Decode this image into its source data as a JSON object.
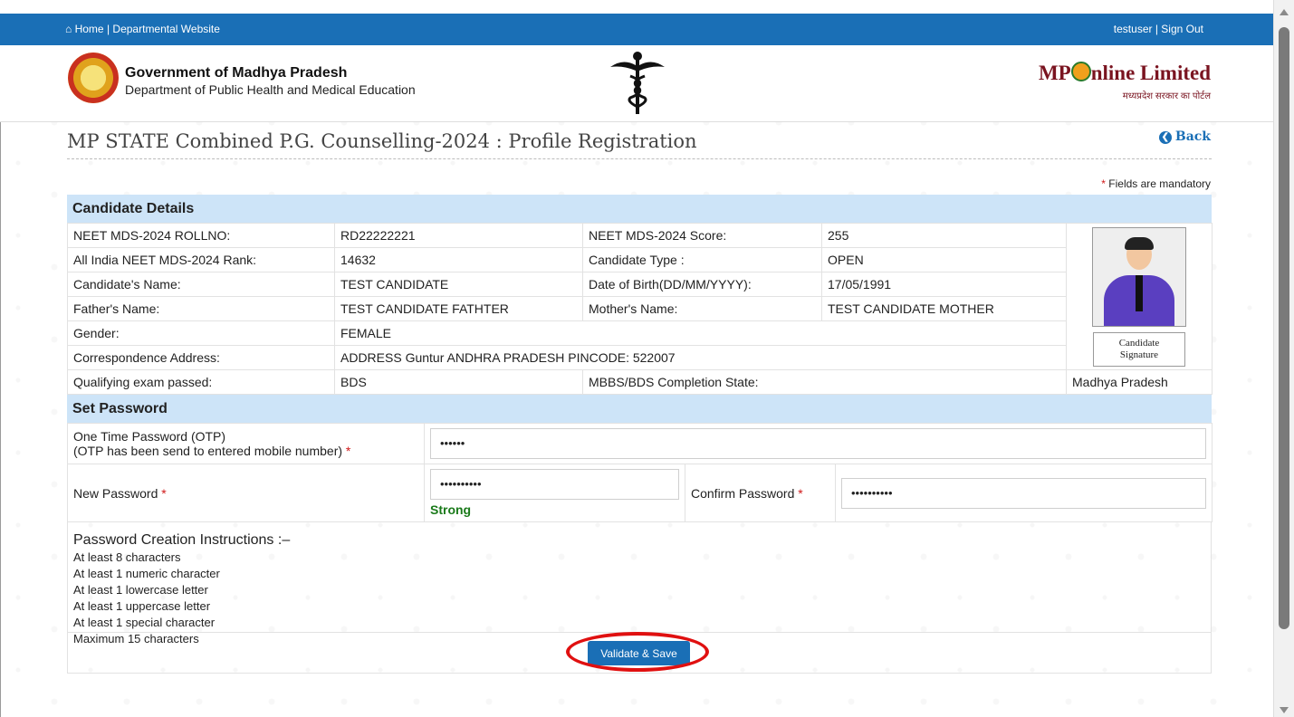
{
  "nav": {
    "home": "Home",
    "separator": "|",
    "departmental": "Departmental Website",
    "user": "testuser",
    "signout": "Sign Out"
  },
  "header": {
    "gov_title": "Government of Madhya Pradesh",
    "gov_sub": "Department of Public Health and Medical Education",
    "mponline_logo": "MP",
    "mponline_logo_rest": "nline Limited",
    "mponline_tagline": "मध्यप्रदेश सरकार का पोर्टल"
  },
  "page": {
    "title": "MP STATE Combined P.G. Counselling-2024 : Profile Registration",
    "back": "Back",
    "mandatory_note": "Fields are mandatory",
    "asterisk": "*"
  },
  "candidate": {
    "heading": "Candidate Details",
    "rows": [
      {
        "l1": "NEET MDS-2024 ROLLNO:",
        "v1": "RD22222221",
        "l2": "NEET MDS-2024 Score:",
        "v2": "255"
      },
      {
        "l1": "All India NEET MDS-2024 Rank:",
        "v1": "14632",
        "l2": "Candidate Type :",
        "v2": "OPEN"
      },
      {
        "l1": "Candidate's Name:",
        "v1": "TEST CANDIDATE",
        "l2": "Date of Birth(DD/MM/YYYY):",
        "v2": "17/05/1991"
      },
      {
        "l1": "Father's Name:",
        "v1": "TEST CANDIDATE FATHTER",
        "l2": "Mother's Name:",
        "v2": "TEST CANDIDATE MOTHER"
      }
    ],
    "gender_label": "Gender:",
    "gender": "FEMALE",
    "address_label": "Correspondence Address:",
    "address": "ADDRESS Guntur ANDHRA PRADESH PINCODE: 522007",
    "qual_label": "Qualifying exam passed:",
    "qual": "BDS",
    "state_label": "MBBS/BDS Completion State:",
    "state": "Madhya Pradesh",
    "signature_line1": "Candidate",
    "signature_line2": "Signature"
  },
  "password": {
    "heading": "Set Password",
    "otp_label": "One Time Password (OTP)",
    "otp_hint": "(OTP has been send to entered mobile number)",
    "otp_value": "••••••",
    "new_label": "New Password",
    "new_value": "••••••••••",
    "strength": "Strong",
    "confirm_label": "Confirm Password",
    "confirm_value": "••••••••••"
  },
  "instructions": {
    "heading": "Password Creation Instructions :–",
    "items": [
      "At least 8 characters",
      "At least 1 numeric character",
      "At least 1 lowercase letter",
      "At least 1 uppercase letter",
      "At least 1 special character",
      "Maximum 15 characters"
    ]
  },
  "actions": {
    "validate_save": "Validate & Save"
  }
}
